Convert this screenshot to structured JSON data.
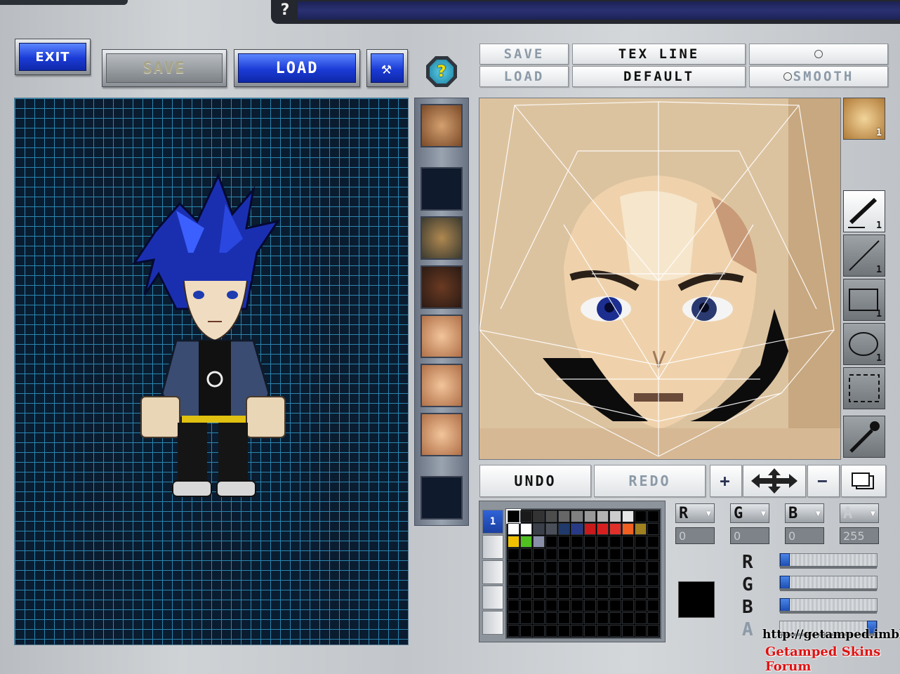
{
  "topbar": {
    "help_glyph": "?"
  },
  "toolbar": {
    "exit_label": "EXIT",
    "save_label": "SAVE",
    "load_label": "LOAD",
    "hammer_glyph": "⚒",
    "help_glyph": "?"
  },
  "tex_toolbar": {
    "save_label": "SAVE",
    "load_label": "LOAD",
    "tex_line_label": "TEX LINE",
    "default_label": "DEFAULT",
    "radio_blank_label": "",
    "smooth_label": "SMOOTH"
  },
  "side_icons": {
    "face_count": "1"
  },
  "tools": [
    {
      "name": "pen",
      "count": "1"
    },
    {
      "name": "line",
      "count": "1"
    },
    {
      "name": "rectangle",
      "count": "1"
    },
    {
      "name": "ellipse",
      "count": "1"
    },
    {
      "name": "select"
    },
    {
      "name": "eyedropper"
    }
  ],
  "edit_bar": {
    "undo_label": "UNDO",
    "redo_label": "REDO",
    "zoom_in": "+",
    "zoom_out": "−"
  },
  "palette": {
    "tab_selected": "1",
    "row1": [
      "#000000",
      "#1a1a1a",
      "#333333",
      "#4d4d4d",
      "#666666",
      "#808080",
      "#999999",
      "#b3b3b3",
      "#cccccc",
      "#e6e6e6"
    ],
    "row2": [
      "#ffffff",
      "#ffffff",
      "#3a3f4a",
      "#4a4f5a",
      "#1f3a6b",
      "#283a86",
      "#c81a1a",
      "#d62020",
      "#e0302a",
      "#f06020",
      "#a08020"
    ],
    "row3": [
      "#f0c000",
      "#50c020",
      "#8a8fa8"
    ]
  },
  "color": {
    "r_label": "R",
    "g_label": "G",
    "b_label": "B",
    "a_label": "A",
    "r": "0",
    "g": "0",
    "b": "0",
    "a": "255",
    "current_swatch": "#000000"
  },
  "watermark": {
    "url": "http://getamped.imbbs.in",
    "forum": "Getamped Skins Forum"
  }
}
